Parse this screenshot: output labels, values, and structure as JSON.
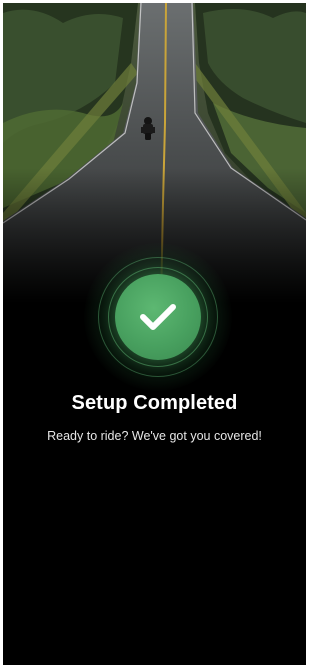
{
  "setup": {
    "title": "Setup Completed",
    "subtitle": "Ready to ride? We've got you covered!"
  },
  "hero": {
    "image_subject": "motorcyclist riding on a straight tree-lined road"
  },
  "icons": {
    "status": "checkmark-icon"
  },
  "colors": {
    "background": "#000000",
    "success_green": "#4ea865",
    "title_text": "#ffffff",
    "subtitle_text": "#e6e6e6"
  }
}
